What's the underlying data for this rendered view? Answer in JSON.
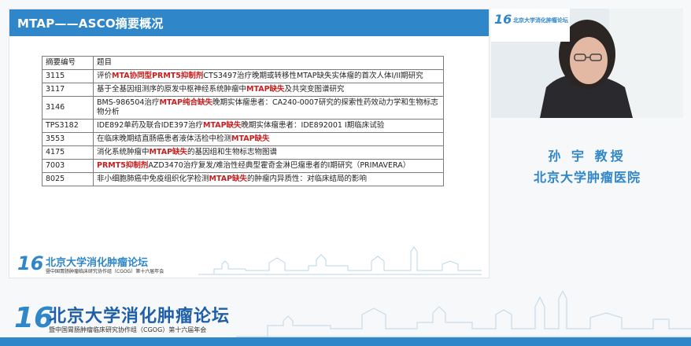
{
  "slide": {
    "title": "MTAP——ASCO摘要概况",
    "table": {
      "headers": [
        "摘要编号",
        "题目"
      ],
      "rows": [
        {
          "id": "3115",
          "parts": [
            {
              "t": "评价",
              "hi": false
            },
            {
              "t": "MTA协同型PRMT5抑制剂",
              "hi": true
            },
            {
              "t": "CTS3497治疗晚期或转移性MTAP缺失实体瘤的首次人体I/II期研究",
              "hi": false
            }
          ]
        },
        {
          "id": "3117",
          "parts": [
            {
              "t": "基于全基因组测序的原发中枢神经系统肿瘤中",
              "hi": false
            },
            {
              "t": "MTAP缺失",
              "hi": true
            },
            {
              "t": "及共突变图谱研究",
              "hi": false
            }
          ]
        },
        {
          "id": "3146",
          "parts": [
            {
              "t": "BMS-986504治疗",
              "hi": false
            },
            {
              "t": "MTAP纯合缺失",
              "hi": true
            },
            {
              "t": "晚期实体瘤患者：CA240-0007研究的探索性药效动力学和生物标志物分析",
              "hi": false
            }
          ]
        },
        {
          "id": "TPS3182",
          "parts": [
            {
              "t": "IDE892单药及联合IDE397治疗",
              "hi": false
            },
            {
              "t": "MTAP缺失",
              "hi": true
            },
            {
              "t": "晚期实体瘤患者：IDE892001 I期临床试验",
              "hi": false
            }
          ]
        },
        {
          "id": "3553",
          "parts": [
            {
              "t": "在临床晚期结直肠癌患者液体活检中检测",
              "hi": false
            },
            {
              "t": "MTAP缺失",
              "hi": true
            }
          ]
        },
        {
          "id": "4175",
          "parts": [
            {
              "t": "消化系统肿瘤中",
              "hi": false
            },
            {
              "t": "MTAP缺失",
              "hi": true
            },
            {
              "t": "的基因组和生物标志物图谱",
              "hi": false
            }
          ]
        },
        {
          "id": "7003",
          "parts": [
            {
              "t": "PRMT5抑制剂",
              "hi": true
            },
            {
              "t": "AZD3470治疗复发/难治性经典型霍奇金淋巴瘤患者的I期研究（PRIMAVERA）",
              "hi": false
            }
          ]
        },
        {
          "id": "8025",
          "parts": [
            {
              "t": "非小细胞肺癌中免疫组织化学检测",
              "hi": false
            },
            {
              "t": "MTAP缺失",
              "hi": true
            },
            {
              "t": "的肿瘤内异质性：对临床结局的影响",
              "hi": false
            }
          ]
        }
      ]
    },
    "footer": {
      "num": "16",
      "title": "北京大学消化肿瘤论坛",
      "subtitle": "暨中国胃肠肿瘤临床研究协作组（CGOG）第十六届年会"
    }
  },
  "video": {
    "mini_num": "16",
    "mini_title": "北京大学消化肿瘤论坛"
  },
  "speaker": {
    "name": "孙 宇 教授",
    "affiliation": "北京大学肿瘤医院"
  },
  "banner": {
    "num": "16",
    "title": "北京大学消化肿瘤论坛",
    "subtitle": "暨中国胃肠肿瘤临床研究协作组（CGOG）第十六届年会"
  },
  "colors": {
    "accent": "#2f86c9",
    "highlight": "#c81e1e"
  }
}
